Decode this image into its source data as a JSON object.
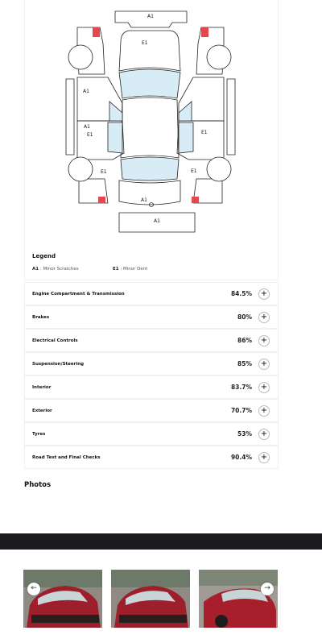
{
  "diagram": {
    "labels": {
      "top_a1": "A1",
      "hood_e1": "E1",
      "left_front_a1": "A1",
      "left_rear_a1": "A1",
      "left_rear_e1": "E1",
      "right_rear_e1": "E1",
      "left_sill_e1": "E1",
      "right_sill_e1": "E1",
      "trunk_a1": "A1",
      "bumper_a1": "A1"
    },
    "colors": {
      "glass": "#d8ecf6",
      "damage": "#e3474f",
      "outline": "#222222"
    }
  },
  "legend": {
    "title": "Legend",
    "items": [
      {
        "code": "A1",
        "text": " : Minor Scratches"
      },
      {
        "code": "E1",
        "text": " : Minor Dent"
      }
    ]
  },
  "scores": [
    {
      "label": "Engine Compartment & Transmission",
      "value": "84.5%"
    },
    {
      "label": "Brakes",
      "value": "80%"
    },
    {
      "label": "Electrical Controls",
      "value": "86%"
    },
    {
      "label": "Suspension/Steering",
      "value": "85%"
    },
    {
      "label": "Interior",
      "value": "83.7%"
    },
    {
      "label": "Exterior",
      "value": "70.7%"
    },
    {
      "label": "Tyres",
      "value": "53%"
    },
    {
      "label": "Road Test and Final Checks",
      "value": "90.4%"
    }
  ],
  "expand_symbol": "+",
  "photos": {
    "title": "Photos",
    "prev_symbol": "←",
    "next_symbol": "→"
  }
}
